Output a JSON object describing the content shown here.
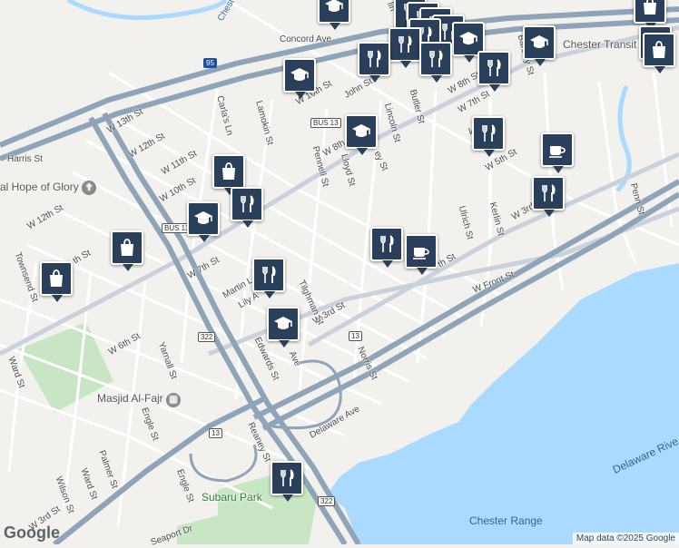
{
  "streets": [
    {
      "id": "concord",
      "text": "Concord Ave"
    },
    {
      "id": "harris",
      "text": "Harris St"
    },
    {
      "id": "w13",
      "text": "W 13th St"
    },
    {
      "id": "w12a",
      "text": "W 12th St"
    },
    {
      "id": "w11",
      "text": "W 11th St"
    },
    {
      "id": "w10a",
      "text": "W 10th St"
    },
    {
      "id": "w12b",
      "text": "W 12th St"
    },
    {
      "id": "w10b",
      "text": "W 10th St"
    },
    {
      "id": "w8a",
      "text": "W 8th"
    },
    {
      "id": "w8b",
      "text": "W 8th St"
    },
    {
      "id": "w7a",
      "text": "W 7th St"
    },
    {
      "id": "w7b",
      "text": "W 7th St"
    },
    {
      "id": "w6",
      "text": "W 6th St"
    },
    {
      "id": "w5",
      "text": "W 5th St"
    },
    {
      "id": "w3a",
      "text": "W 3rd St"
    },
    {
      "id": "w3b",
      "text": "W 3rd"
    },
    {
      "id": "w3c",
      "text": "W 3rd St"
    },
    {
      "id": "wfront",
      "text": "W Front St"
    },
    {
      "id": "carlas",
      "text": "Carla's Ln"
    },
    {
      "id": "lamokin",
      "text": "Lamokin St"
    },
    {
      "id": "pennell",
      "text": "Pennell St"
    },
    {
      "id": "lloyd",
      "text": "Lloyd St"
    },
    {
      "id": "lincoln",
      "text": "Lincoln St"
    },
    {
      "id": "butler",
      "text": "Butler St"
    },
    {
      "id": "john",
      "text": "John St"
    },
    {
      "id": "barclay",
      "text": "Barclay St"
    },
    {
      "id": "kerlin",
      "text": "Kerlin St"
    },
    {
      "id": "ulrich",
      "text": "Ulrich St"
    },
    {
      "id": "penn",
      "text": "Penn St"
    },
    {
      "id": "townsend",
      "text": "Townsend St"
    },
    {
      "id": "ward1",
      "text": "Ward St"
    },
    {
      "id": "ward2",
      "text": "Ward St"
    },
    {
      "id": "yarnall",
      "text": "Yarnall St"
    },
    {
      "id": "engle1",
      "text": "Engle St"
    },
    {
      "id": "engle2",
      "text": "Engle St"
    },
    {
      "id": "palmer",
      "text": "Palmer St"
    },
    {
      "id": "wilson",
      "text": "Wilson St"
    },
    {
      "id": "reaney",
      "text": "Reaney St"
    },
    {
      "id": "edwards",
      "text": "Edwards St"
    },
    {
      "id": "norris",
      "text": "Norris St"
    },
    {
      "id": "delaware",
      "text": "Delaware Ave"
    },
    {
      "id": "seaport",
      "text": "Seaport Dr"
    },
    {
      "id": "martin",
      "text": "Martin L"
    },
    {
      "id": "lily",
      "text": "Lily A"
    },
    {
      "id": "tilghman",
      "text": "Tilghman St"
    },
    {
      "id": "ave",
      "text": "Ave"
    },
    {
      "id": "eystr",
      "text": "ey St"
    },
    {
      "id": "thst",
      "text": "th St"
    },
    {
      "id": "wpart",
      "text": "W"
    },
    {
      "id": "linpart",
      "text": "lin"
    },
    {
      "id": "ethst",
      "text": "th St"
    },
    {
      "id": "chester_top",
      "text": "Chester"
    }
  ],
  "pois": [
    {
      "id": "hope",
      "text": "al Hope of Glory"
    },
    {
      "id": "masjid",
      "text": "Masjid Al-Fajr"
    },
    {
      "id": "subaru",
      "text": "Subaru Park"
    },
    {
      "id": "transit",
      "text": "Chester Transit Ce"
    }
  ],
  "water_labels": [
    {
      "id": "river",
      "text": "Delaware Rive"
    },
    {
      "id": "range",
      "text": "Chester Range"
    }
  ],
  "shields": [
    {
      "id": "i95",
      "text": "95"
    },
    {
      "id": "b13a",
      "text": "BUS 13"
    },
    {
      "id": "b13b",
      "text": "BUS 13"
    },
    {
      "id": "r322a",
      "text": "322"
    },
    {
      "id": "r13a",
      "text": "13"
    },
    {
      "id": "r13b",
      "text": "13"
    },
    {
      "id": "r322b",
      "text": "322"
    }
  ],
  "markers": [
    {
      "id": "m1",
      "icon": "school-icon"
    },
    {
      "id": "m2",
      "icon": "shopping-bag-icon"
    },
    {
      "id": "m3",
      "icon": "restaurant-icon"
    },
    {
      "id": "m4",
      "icon": "restaurant-icon"
    },
    {
      "id": "m5",
      "icon": "restaurant-icon"
    },
    {
      "id": "m6",
      "icon": "restaurant-icon"
    },
    {
      "id": "m7",
      "icon": "restaurant-icon"
    },
    {
      "id": "m8",
      "icon": "school-icon"
    },
    {
      "id": "m9",
      "icon": "restaurant-icon"
    },
    {
      "id": "m10",
      "icon": "school-icon"
    },
    {
      "id": "m11",
      "icon": "shopping-bag-icon"
    },
    {
      "id": "m12",
      "icon": "shopping-bag-icon"
    },
    {
      "id": "m13",
      "icon": "school-icon"
    },
    {
      "id": "m14",
      "icon": "restaurant-icon"
    },
    {
      "id": "m15",
      "icon": "shopping-bag-icon"
    },
    {
      "id": "m16",
      "icon": "school-icon"
    },
    {
      "id": "m17",
      "icon": "restaurant-icon"
    },
    {
      "id": "m18",
      "icon": "restaurant-icon"
    },
    {
      "id": "m19",
      "icon": "school-icon"
    },
    {
      "id": "m20",
      "icon": "restaurant-icon"
    },
    {
      "id": "m21",
      "icon": "cafe-icon"
    },
    {
      "id": "m22",
      "icon": "restaurant-icon"
    },
    {
      "id": "m23",
      "icon": "restaurant-icon"
    },
    {
      "id": "m24",
      "icon": "cafe-icon"
    },
    {
      "id": "m25",
      "icon": "school-icon"
    },
    {
      "id": "m26",
      "icon": "restaurant-icon"
    },
    {
      "id": "m27",
      "icon": "shopping-bag-icon"
    },
    {
      "id": "m28",
      "icon": "restaurant-icon"
    }
  ],
  "footer": {
    "logo": "Google",
    "copyright": "Map data ©2025 Google"
  },
  "colors": {
    "water": "#aadaff",
    "land": "#f2f1ee",
    "park": "#c8e6c4",
    "highway": "#8fa3b9",
    "marker": "#2a3f5a"
  }
}
